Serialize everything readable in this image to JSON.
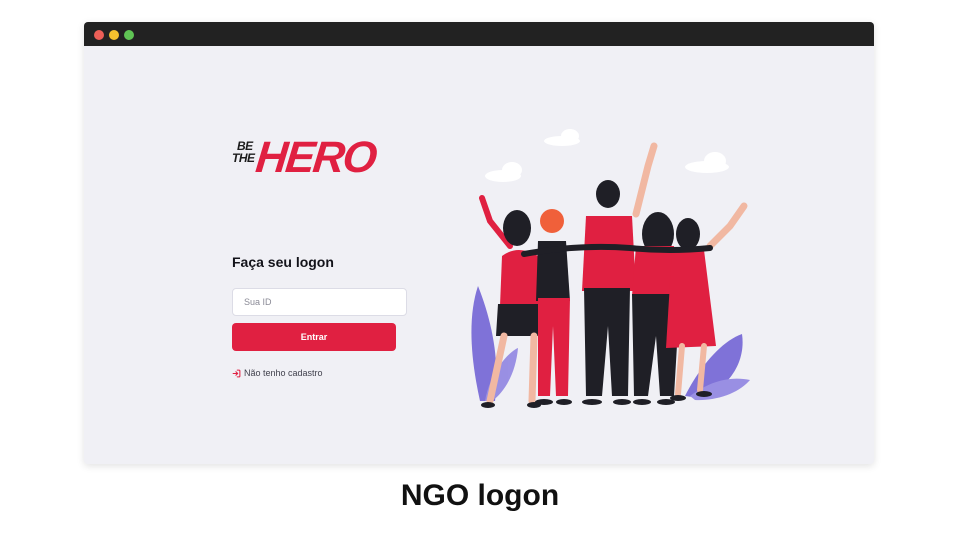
{
  "window": {
    "controls": [
      "close",
      "minimize",
      "maximize"
    ],
    "colors": {
      "close": "#ec5f57",
      "minimize": "#f5c12e",
      "maximize": "#5fc454"
    }
  },
  "logo": {
    "line1": "BE",
    "line2": "THE",
    "word": "HERO"
  },
  "form": {
    "heading": "Faça seu logon",
    "id_placeholder": "Sua ID",
    "id_value": "",
    "submit_label": "Entrar",
    "register_link": "Não tenho cadastro",
    "register_icon": "log-in-icon"
  },
  "illustration": {
    "icon": "group-of-friends-illustration"
  },
  "caption": "NGO logon",
  "colors": {
    "accent": "#e02041",
    "background": "#f0f0f5",
    "titlebar": "#222222"
  }
}
